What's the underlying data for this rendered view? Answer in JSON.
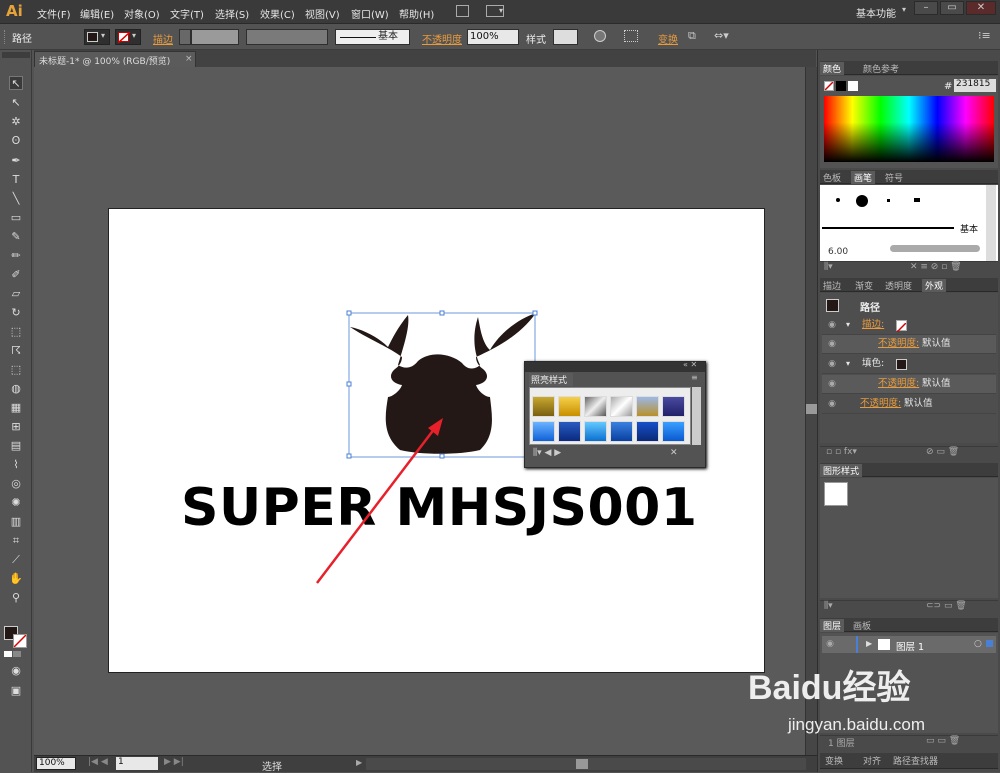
{
  "app": {
    "logo": "Ai",
    "workspace": "基本功能"
  },
  "menu": [
    "文件(F)",
    "编辑(E)",
    "对象(O)",
    "文字(T)",
    "选择(S)",
    "效果(C)",
    "视图(V)",
    "窗口(W)",
    "帮助(H)"
  ],
  "control": {
    "object_type": "路径",
    "stroke_label": "描边",
    "brush": "基本",
    "opacity_label": "不透明度",
    "opacity_value": "100%",
    "style_label": "样式",
    "transform_label": "变换"
  },
  "document": {
    "tab_title": "未标题-1* @ 100% (RGB/预览)"
  },
  "artboard": {
    "text": "SUPER MHSJS001"
  },
  "graphic_styles_float": {
    "title": "照亮样式"
  },
  "color_panel": {
    "tabs": [
      "颜色",
      "颜色参考"
    ],
    "hex_label": "#",
    "hex_value": "231815"
  },
  "brush_panel": {
    "tabs": [
      "色板",
      "画笔",
      "符号"
    ],
    "basic_label": "基本",
    "size": "6.00"
  },
  "appearance_panel": {
    "tabs": [
      "描边",
      "渐变",
      "透明度",
      "外观"
    ],
    "title": "路径",
    "rows": [
      {
        "label": "描边:",
        "sub": "",
        "value": ""
      },
      {
        "label": "",
        "sub": "不透明度:",
        "value": "默认值"
      },
      {
        "label": "填色:",
        "sub": "",
        "value": ""
      },
      {
        "label": "",
        "sub": "不透明度:",
        "value": "默认值"
      },
      {
        "label": "不透明度:",
        "sub": "",
        "value": "默认值"
      }
    ]
  },
  "graphic_styles_panel": {
    "tab": "图形样式"
  },
  "layers_panel": {
    "tabs": [
      "图层",
      "画板"
    ],
    "layer_name": "图层 1",
    "footer": "1 图层"
  },
  "bottom_tabs": [
    "变换",
    "对齐",
    "路径查找器"
  ],
  "status": {
    "zoom": "100%",
    "page": "1",
    "tool": "选择"
  },
  "watermark": {
    "brand": "Baidu经验",
    "url": "jingyan.baidu.com"
  },
  "colors": {
    "fill": "#231815",
    "accent": "#e89b3c"
  }
}
